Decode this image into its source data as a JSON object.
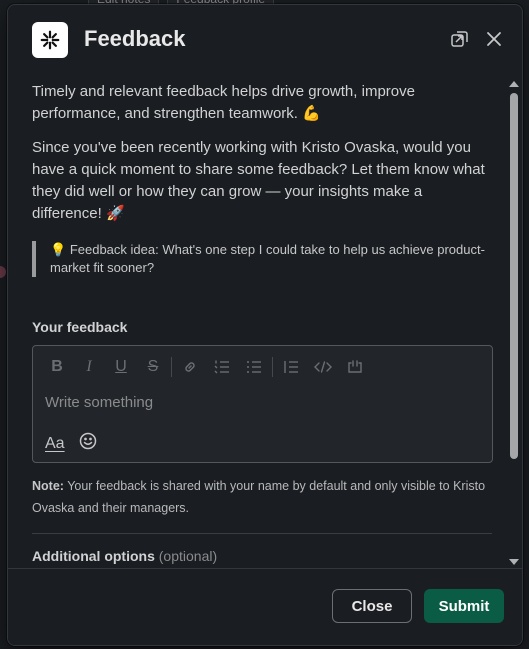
{
  "background": {
    "tabs": [
      "Edit notes",
      "Feedback profile"
    ]
  },
  "modal": {
    "title": "Feedback",
    "logo_icon": "starburst-icon",
    "header_icons": [
      "open-in-window-icon",
      "close-icon"
    ]
  },
  "content": {
    "intro": "Timely and relevant feedback helps drive growth, improve performance, and strengthen teamwork.",
    "intro_emoji": "💪",
    "request": "Since you've been recently working with Kristo Ovaska, would you have a quick moment to share some feedback? Let them know what they did well or how they can grow — your insights make a difference!",
    "request_emoji": "🚀",
    "idea_emoji": "💡",
    "idea": "Feedback idea: What's one step I could take to help us achieve product-market fit sooner?",
    "feedback_label": "Your feedback",
    "editor_placeholder": "Write something",
    "format_label": "Aa",
    "note_label": "Note:",
    "note_text": "Your feedback is shared with your name by default and only visible to Kristo Ovaska and their managers.",
    "additional_options_label": "Additional options",
    "additional_options_optional": "(optional)"
  },
  "toolbar": {
    "bold": "B",
    "italic": "I",
    "underline": "U",
    "strike": "S"
  },
  "footer": {
    "close_label": "Close",
    "submit_label": "Submit"
  },
  "colors": {
    "background": "#1a1d21",
    "submit": "#0a5c44",
    "text": "#d1d2d3"
  }
}
